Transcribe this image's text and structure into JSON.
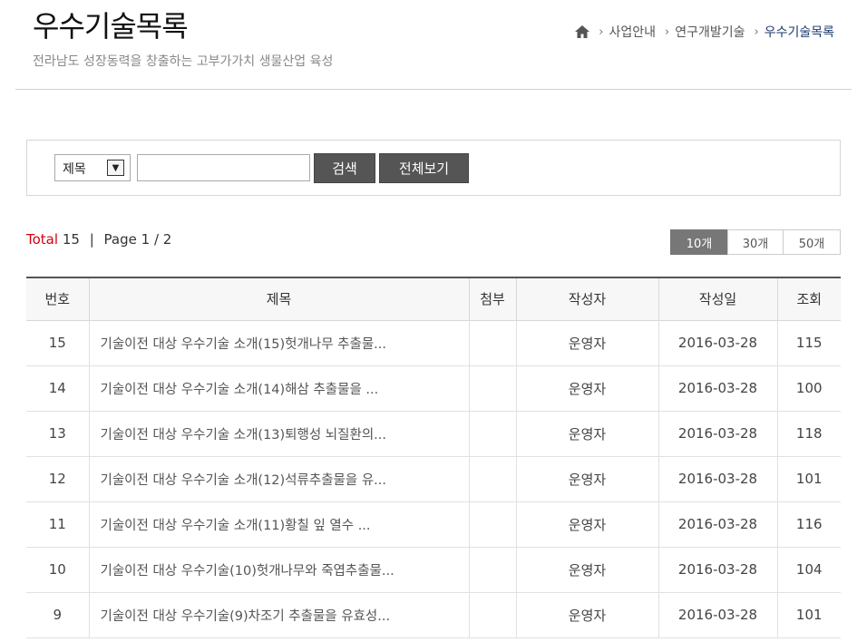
{
  "header": {
    "title": "우수기술목록",
    "subtitle": "전라남도 성장동력을 창출하는 고부가가치 생물산업 육성",
    "breadcrumb": [
      "사업안내",
      "연구개발기술",
      "우수기술목록"
    ]
  },
  "search": {
    "field_selected": "제목",
    "keyword_value": "",
    "search_label": "검색",
    "view_all_label": "전체보기"
  },
  "summary": {
    "total_label": "Total",
    "total_count": "15",
    "divider": "|",
    "page_text": "Page 1 / 2"
  },
  "per_page": {
    "options": [
      "10개",
      "30개",
      "50개"
    ],
    "active": "10개"
  },
  "table": {
    "columns": [
      "번호",
      "제목",
      "첨부",
      "작성자",
      "작성일",
      "조회"
    ],
    "rows": [
      {
        "no": "15",
        "title": "기술이전 대상 우수기술 소개(15)헛개나무 추출물...",
        "attach": "",
        "author": "운영자",
        "date": "2016-03-28",
        "views": "115"
      },
      {
        "no": "14",
        "title": "기술이전 대상 우수기술 소개(14)해삼 추출물을 ...",
        "attach": "",
        "author": "운영자",
        "date": "2016-03-28",
        "views": "100"
      },
      {
        "no": "13",
        "title": "기술이전 대상 우수기술 소개(13)퇴행성 뇌질환의...",
        "attach": "",
        "author": "운영자",
        "date": "2016-03-28",
        "views": "118"
      },
      {
        "no": "12",
        "title": "기술이전 대상 우수기술 소개(12)석류추출물을 유...",
        "attach": "",
        "author": "운영자",
        "date": "2016-03-28",
        "views": "101"
      },
      {
        "no": "11",
        "title": "기술이전 대상 우수기술 소개(11)황칠 잎 열수 ...",
        "attach": "",
        "author": "운영자",
        "date": "2016-03-28",
        "views": "116"
      },
      {
        "no": "10",
        "title": "기술이전 대상 우수기술(10)헛개나무와 죽엽추출물...",
        "attach": "",
        "author": "운영자",
        "date": "2016-03-28",
        "views": "104"
      },
      {
        "no": "9",
        "title": "기술이전 대상 우수기술(9)차조기 추출물을 유효성...",
        "attach": "",
        "author": "운영자",
        "date": "2016-03-28",
        "views": "101"
      }
    ]
  }
}
